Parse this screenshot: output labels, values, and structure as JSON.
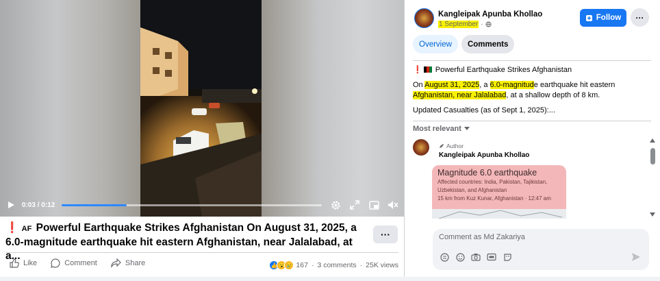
{
  "video": {
    "current_time": "0:03",
    "duration": "0:12",
    "time_display": "0:03 / 0:12",
    "progress_fraction": 0.25
  },
  "post": {
    "title_prefix": "AF",
    "title": "Powerful Earthquake Strikes Afghanistan On August 31, 2025, a 6.0-magnitude earthquake hit eastern Afghanistan, near Jalalabad, at a...",
    "more_label": "···",
    "actions": {
      "like": "Like",
      "comment": "Comment",
      "share": "Share"
    },
    "stats": {
      "reaction_count": "167",
      "comments": "3 comments",
      "views": "25K views"
    }
  },
  "panel": {
    "page_name": "Kangleipak Apunba Khollao",
    "date": "1 September",
    "date_sep": "·",
    "follow_label": "Follow",
    "more_label": "···",
    "tabs": [
      {
        "label": "Overview",
        "active": true
      },
      {
        "label": "Comments",
        "active": false
      }
    ],
    "description": {
      "headline": "Powerful Earthquake Strikes Afghanistan",
      "p1_a": "On ",
      "p1_date": "August 31, 2025",
      "p1_b": ", a ",
      "p1_mag": "6.0-magnitud",
      "p1_c": "e earthquake hit eastern ",
      "p1_place": "Afghanistan, near Jalalabad",
      "p1_d": ", at a shallow depth of 8 km.",
      "p2": "Updated Casualties (as of Sept 1, 2025):..."
    },
    "sort_label": "Most relevant",
    "comment": {
      "badge": "Author",
      "author": "Kangleipak Apunba Khollao",
      "card": {
        "title": "Magnitude 6.0 earthquake",
        "line1": "Affected countries: India, Pakistan, Tajikistan,",
        "line2": "Uzbekistan, and Afghanistan",
        "line3": "15 km from Kuz Kunar, Afghanistan · 12:47 am"
      }
    },
    "composer": {
      "placeholder": "Comment as Md Zakariya"
    }
  },
  "colors": {
    "accent": "#1877f2",
    "highlight": "#f8f000",
    "card": "#f4b7b9",
    "alert": "#e41e3f"
  },
  "icons": [
    "play-icon",
    "settings-icon",
    "expand-icon",
    "pip-icon",
    "volume-muted-icon",
    "like-icon",
    "comment-icon",
    "share-icon",
    "globe-icon",
    "follow-icon",
    "caret-down-icon",
    "pencil-icon",
    "sticker-icon",
    "emoji-icon",
    "camera-icon",
    "gif-icon",
    "avatar-sticker-icon",
    "send-icon"
  ]
}
